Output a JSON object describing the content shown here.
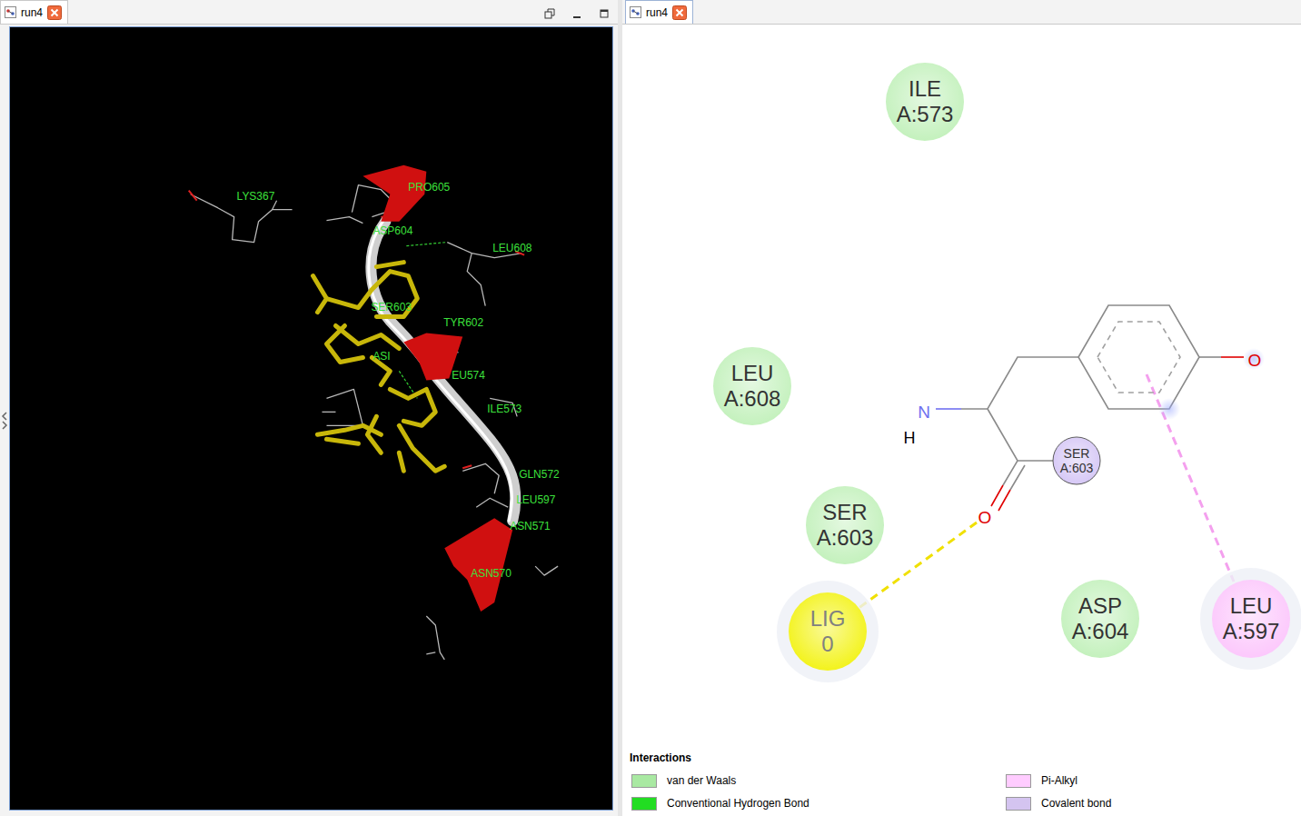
{
  "tabs": [
    {
      "label": "run4",
      "selected": true
    },
    {
      "label": "run4",
      "selected": true
    }
  ],
  "viewer": {
    "labels": [
      {
        "text": "LYS367"
      },
      {
        "text": "PRO605"
      },
      {
        "text": "ASP604"
      },
      {
        "text": "LEU608"
      },
      {
        "text": "SER603"
      },
      {
        "text": "TYR602"
      },
      {
        "text": "ASI"
      },
      {
        "text": "EU574"
      },
      {
        "text": "ILE573"
      },
      {
        "text": "GLN572"
      },
      {
        "text": "LEU597"
      },
      {
        "text": "ASN571"
      },
      {
        "text": "ASN570"
      }
    ]
  },
  "diagram": {
    "residues": [
      {
        "name": "ILE",
        "id": "A:573",
        "kind": "residue",
        "color": "#c4f1bd"
      },
      {
        "name": "LEU",
        "id": "A:608",
        "kind": "residue",
        "color": "#c4f1bd"
      },
      {
        "name": "SER",
        "id": "A:603",
        "kind": "residue",
        "color": "#c4f1bd"
      },
      {
        "name": "LIG",
        "id": "0",
        "kind": "ligand",
        "color": "#f3f31c"
      },
      {
        "name": "ASP",
        "id": "A:604",
        "kind": "residue",
        "color": "#c4f1bd"
      },
      {
        "name": "LEU",
        "id": "A:597",
        "kind": "residue",
        "color": "#fcc8fc"
      },
      {
        "name": "SER",
        "id": "A:603",
        "kind": "atom",
        "color": "#d6c8f6"
      }
    ],
    "ligand": {
      "atoms": [
        {
          "symbol": "N",
          "color": "#7070f0"
        },
        {
          "symbol": "H",
          "color": "#000000"
        },
        {
          "symbol": "O",
          "color": "#e00000"
        },
        {
          "symbol": "O",
          "color": "#e00000"
        }
      ]
    },
    "contacts": [
      {
        "color": "#f0e000"
      },
      {
        "color": "#f4a0ee"
      }
    ]
  },
  "legend": {
    "title": "Interactions",
    "items": [
      {
        "label": "van der Waals",
        "color": "#a9e9a2"
      },
      {
        "label": "Pi-Alkyl",
        "color": "#ffccff"
      },
      {
        "label": "Conventional Hydrogen Bond",
        "color": "#22dd22"
      },
      {
        "label": "Covalent bond",
        "color": "#d4c4f0"
      }
    ]
  }
}
